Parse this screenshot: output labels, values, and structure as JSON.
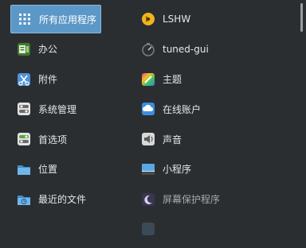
{
  "categories": [
    {
      "label": "所有应用程序",
      "icon": "grid-icon"
    },
    {
      "label": "办公",
      "icon": "office-icon"
    },
    {
      "label": "附件",
      "icon": "accessories-icon"
    },
    {
      "label": "系统管理",
      "icon": "system-admin-icon"
    },
    {
      "label": "首选项",
      "icon": "preferences-icon"
    },
    {
      "label": "位置",
      "icon": "folder-icon"
    },
    {
      "label": "最近的文件",
      "icon": "recent-folder-icon"
    }
  ],
  "apps": [
    {
      "label": "LSHW",
      "icon": "lshw-icon"
    },
    {
      "label": "tuned-gui",
      "icon": "tuned-icon"
    },
    {
      "label": "主题",
      "icon": "theme-icon"
    },
    {
      "label": "在线账户",
      "icon": "online-accounts-icon"
    },
    {
      "label": "声音",
      "icon": "sound-icon"
    },
    {
      "label": "小程序",
      "icon": "applets-icon"
    },
    {
      "label": "屏幕保护程序",
      "icon": "screensaver-icon"
    },
    {
      "label": "",
      "icon": "partially-visible-icon"
    }
  ]
}
